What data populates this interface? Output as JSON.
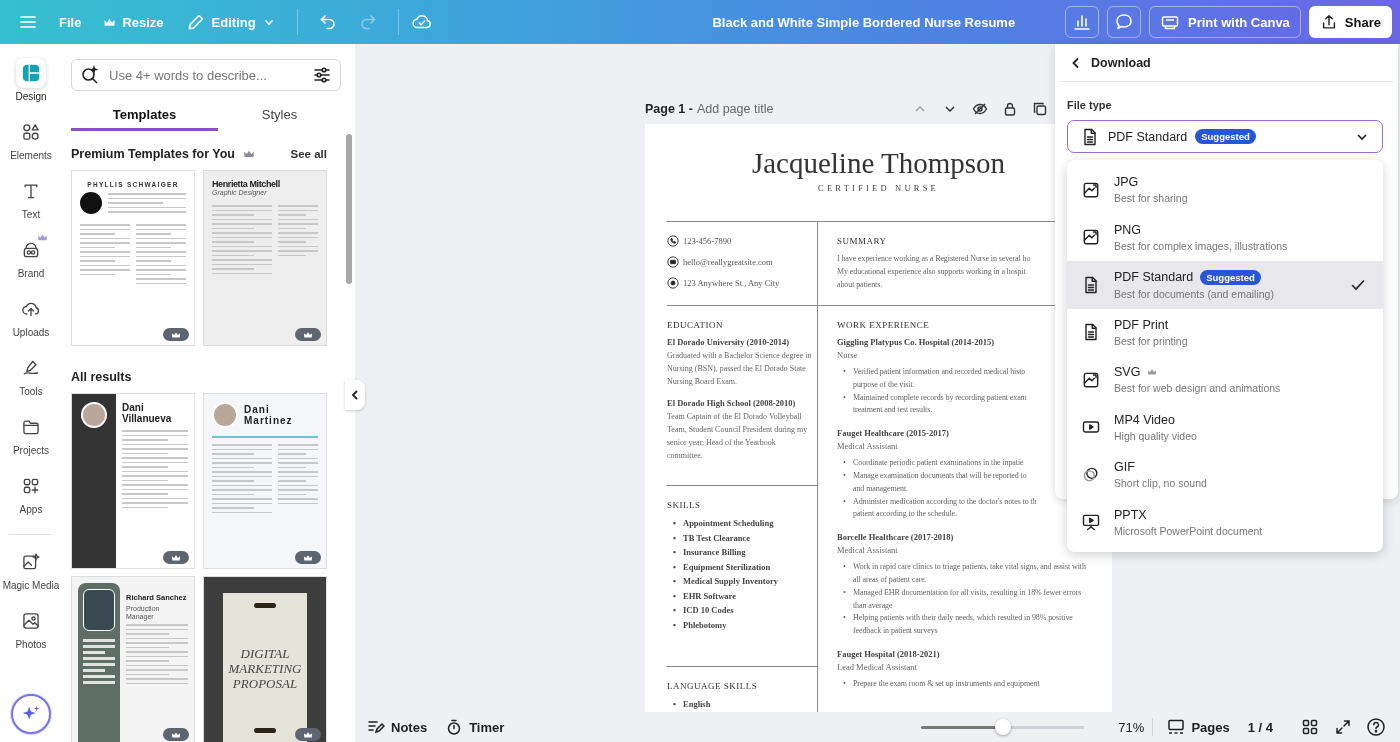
{
  "topbar": {
    "file_menu": "File",
    "resize_button": "Resize",
    "mode_button": "Editing",
    "undo": {
      "disabled": false
    },
    "redo": {
      "disabled": true
    },
    "title": "Black and White Simple Bordered Nurse Resume",
    "print_button": "Print with Canva",
    "share_button": "Share"
  },
  "rail": {
    "main": [
      {
        "label": "Design",
        "selected": true,
        "premium": false
      },
      {
        "label": "Elements",
        "selected": false,
        "premium": false
      },
      {
        "label": "Text",
        "selected": false,
        "premium": false
      },
      {
        "label": "Brand",
        "selected": false,
        "premium": true
      },
      {
        "label": "Uploads",
        "selected": false,
        "premium": false
      },
      {
        "label": "Tools",
        "selected": false,
        "premium": false
      },
      {
        "label": "Projects",
        "selected": false,
        "premium": false
      },
      {
        "label": "Apps",
        "selected": false,
        "premium": false
      }
    ],
    "more": [
      {
        "label": "Magic Media",
        "selected": false,
        "premium": false
      },
      {
        "label": "Photos",
        "selected": false,
        "premium": false
      }
    ]
  },
  "panel": {
    "search": {
      "placeholder": "Use 4+ words to describe..."
    },
    "tabs": [
      {
        "label": "Templates",
        "selected": true
      },
      {
        "label": "Styles",
        "selected": false
      }
    ],
    "premium_section": {
      "title": "Premium Templates for You",
      "see_all": "See all",
      "templates": [
        {
          "kind": "classic",
          "name": "PHYLLIS SCHWAIGER",
          "premium": true
        },
        {
          "kind": "gray",
          "name": "Henrietta Mitchell",
          "subtitle": "Graphic Designer",
          "premium": true
        }
      ]
    },
    "results_section": {
      "title": "All results",
      "templates": [
        {
          "kind": "dark-sidebar",
          "name": "Dani Villanueva",
          "premium": true
        },
        {
          "kind": "light-photo",
          "name": "Dani Martinez",
          "premium": true
        },
        {
          "kind": "green-sidebar",
          "name": "Richard Sanchez",
          "subtitle": "Production Manager",
          "premium": true
        },
        {
          "kind": "poster",
          "name": "DIGITAL MARKETING PROPOSAL",
          "premium": true
        }
      ]
    }
  },
  "canvas": {
    "page_header": {
      "label": "Page 1 -",
      "title_field": {
        "placeholder": "Add page title"
      },
      "up_disabled": true
    },
    "resume": {
      "name": "Jacqueline Thompson",
      "role": "CERTIFIED NURSE",
      "contacts": [
        {
          "kind": "phone",
          "text": "123-456-7890"
        },
        {
          "kind": "mail",
          "text": "hello@reallygreatsite.com"
        },
        {
          "kind": "location",
          "text": "123 Anywhere St., Any City"
        }
      ],
      "summary": {
        "heading": "SUMMARY",
        "lines": [
          "I have experience working as a Registered Nurse in several ho",
          "My educational experience also supports working in a hospit",
          "about patients."
        ]
      },
      "education": {
        "heading": "EDUCATION",
        "entries": [
          {
            "title": "El Dorado University (2010-2014)",
            "text": "Graduated with a Bachelor Science degree in Nursing (BSN), passed the El Dorado State Nursing Board Exam."
          },
          {
            "title": "El Dorado High School (2008-2010)",
            "text": "Team Captain of the El Dorado Volleyball Team, Student Council President during my senior year, Head of the Yearbook committee."
          }
        ]
      },
      "skills": {
        "heading": "SKILLS",
        "marker": "•",
        "items": [
          "Appointment Scheduling",
          "TB Test Clearance",
          "Insurance Billing",
          "Equipment Sterilization",
          "Medical Supply Inventory",
          "EHR Software",
          "ICD 10 Codes",
          "Phlebotomy"
        ]
      },
      "languages": {
        "heading": "LANGUAGE SKILLS",
        "marker": "•",
        "items": [
          "English"
        ]
      },
      "work": {
        "heading": "WORK EXPERIENCE",
        "marker": "•",
        "jobs": [
          {
            "title": "Giggling Platypus Co. Hospital (2014-2015)",
            "role": "Nurse",
            "bullets": [
              {
                "lines": [
                  "Verified patient information and recorded medical histo",
                  "purpose of the visit."
                ]
              },
              {
                "lines": [
                  "Maintained complete records by recording patient exam",
                  "treatment and test results."
                ]
              }
            ]
          },
          {
            "title": "Fauget Healthcare (2015-2017)",
            "role": "Medical Assistant",
            "bullets": [
              {
                "lines": [
                  "Coordinate periodic patient examinations in the inpatie"
                ]
              },
              {
                "lines": [
                  "Manage examination documents that will be reported to",
                  "and management."
                ]
              },
              {
                "lines": [
                  "Administer medication according to the doctor's notes to th",
                  "patient according to the schedule."
                ]
              }
            ]
          },
          {
            "title": "Borcelle Healthcare (2017-2018)",
            "role": "Medical Assistant",
            "bullets": [
              {
                "text": "Work in rapid care clinics to triage patients, take vital signs, and assist with all areas of patient care."
              },
              {
                "text": "Managed EHR documentation for all visits, resulting in 18% fewer errors than average"
              },
              {
                "text": "Helping patients with their daily needs, which resulted in 98% positive feedback in patient surveys"
              }
            ]
          },
          {
            "title": "Fauget Hospital  (2018-2021)",
            "role": "Lead Medical Assistant",
            "bullets": [
              {
                "text": "Prepare the exam room & set up instruments and equipment"
              }
            ]
          }
        ]
      }
    }
  },
  "download": {
    "back_label": "Download",
    "file_type_label": "File type",
    "select": {
      "kind": "document",
      "value": "PDF Standard",
      "badge": "Suggested"
    },
    "options": [
      {
        "kind": "image",
        "name": "JPG",
        "description": "Best for sharing",
        "premium": false,
        "selected": false
      },
      {
        "kind": "image",
        "name": "PNG",
        "description": "Best for complex images, illustrations",
        "premium": false,
        "selected": false
      },
      {
        "kind": "document",
        "name": "PDF Standard",
        "badge": "Suggested",
        "description": "Best for documents (and emailing)",
        "premium": false,
        "selected": true
      },
      {
        "kind": "document",
        "name": "PDF Print",
        "description": "Best for printing",
        "premium": false,
        "selected": false
      },
      {
        "kind": "image",
        "name": "SVG",
        "description": "Best for web design and animations",
        "premium": true,
        "selected": false
      },
      {
        "kind": "video",
        "name": "MP4 Video",
        "description": "High quality video",
        "premium": false,
        "selected": false
      },
      {
        "kind": "gif",
        "name": "GIF",
        "description": "Short clip, no sound",
        "premium": false,
        "selected": false
      },
      {
        "kind": "presentation",
        "name": "PPTX",
        "description": "Microsoft PowerPoint document",
        "premium": false,
        "selected": false
      }
    ]
  },
  "bottom_bar": {
    "notes": "Notes",
    "timer": "Timer",
    "zoom": {
      "level": 0.5,
      "reading": "71%"
    },
    "pages": "Pages",
    "page_count": "1 / 4"
  }
}
